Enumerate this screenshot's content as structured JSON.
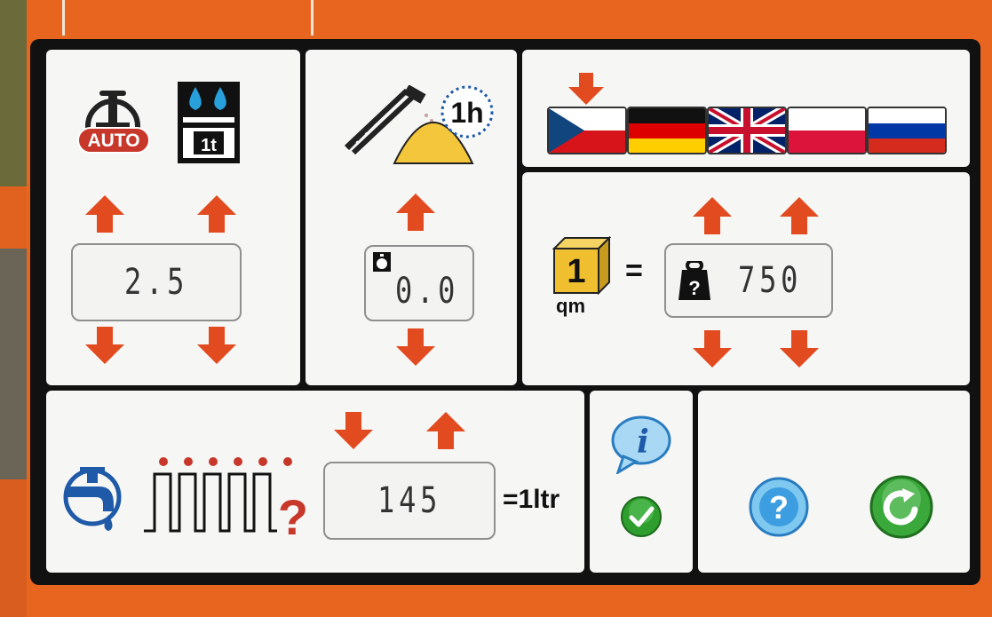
{
  "colors": {
    "arrow": "#e24a1f",
    "panel_bg": "#f6f6f4",
    "frame": "#111111",
    "cube_yellow": "#f0bf30"
  },
  "top_left": {
    "auto_badge": "AUTO",
    "weight_badge": "1t",
    "value": "2.5"
  },
  "top_middle": {
    "timer_badge": "1h",
    "value": "0.0"
  },
  "languages": [
    "Czech",
    "German",
    "English",
    "Polish",
    "Russian"
  ],
  "calibration": {
    "cube_number": "1",
    "unit": "qm",
    "equals": "=",
    "weight_symbol": "?",
    "value": "750"
  },
  "flow": {
    "pulse_question": "?",
    "value": "145",
    "unit_label": "=1ltr"
  },
  "icons": {
    "info": "i",
    "help": "?"
  }
}
